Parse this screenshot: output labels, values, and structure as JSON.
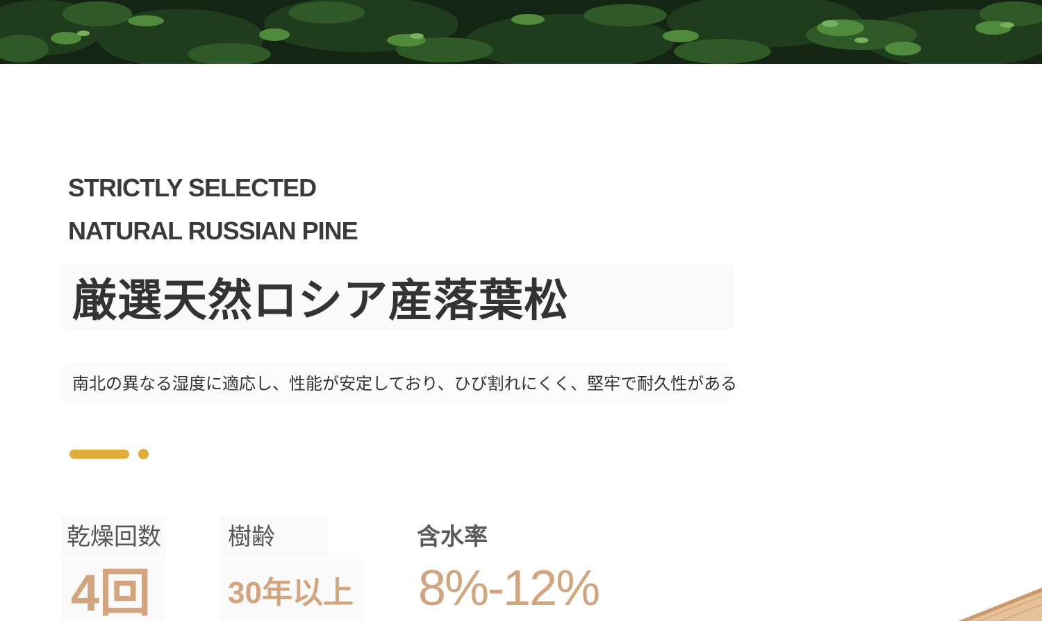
{
  "heading_en": {
    "line1": "STRICTLY SELECTED",
    "line2": "NATURAL RUSSIAN PINE"
  },
  "heading_jp": "厳選天然ロシア産落葉松",
  "description": "南北の異なる湿度に適応し、性能が安定しており、ひび割れにくく、堅牢で耐久性がある",
  "accent_color": "#e0ad3b",
  "value_color": "#d3a57f",
  "stats": [
    {
      "label": "乾燥回数",
      "value": "4回"
    },
    {
      "label": "樹齢",
      "value": "30年以上"
    },
    {
      "label": "含水率",
      "value": "8%-12%"
    }
  ]
}
